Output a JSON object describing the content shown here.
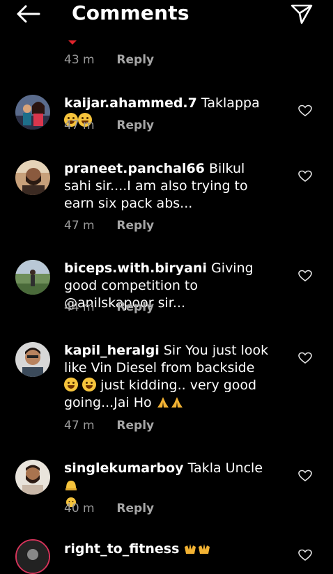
{
  "header": {
    "title": "Comments",
    "back_icon": "arrow-left-icon",
    "share_icon": "paper-plane-icon"
  },
  "reply_label": "Reply",
  "top_meta": {
    "time": "43 m"
  },
  "comments": [
    {
      "username": "kaijar.ahammed.7",
      "text": "Taklappa",
      "time": "47 m"
    },
    {
      "username": "praneet.panchal66",
      "text": "Bilkul sahi sir....I am also trying to earn six pack abs...",
      "time": "47 m"
    },
    {
      "username": "biceps.with.biryani",
      "text": "Giving good competition to @anilskapoor sir...",
      "time": "44 m"
    },
    {
      "username": "kapil_heralgi",
      "text": "Sir You just look like Vin Diesel from backside",
      "text2": "just kidding.. very good going...Jai Ho",
      "time": "47 m"
    },
    {
      "username": "singlekumarboy",
      "text": "Takla Uncle",
      "time": "40 m"
    },
    {
      "username": "right_to_fitness",
      "text": ""
    }
  ],
  "colors": {
    "background": "#000000",
    "meta": "#9a9a9a",
    "accent_red": "#e0242c"
  }
}
